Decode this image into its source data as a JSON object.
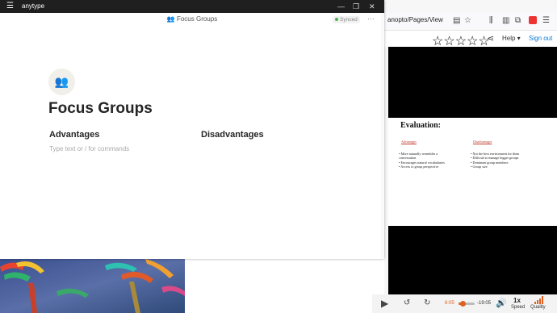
{
  "anytype": {
    "app_name": "anytype",
    "header_title": "👥 Focus Groups",
    "synced_label": "Synced",
    "more_label": "···",
    "page_icon": "👥",
    "page_title": "Focus Groups",
    "advantages_heading": "Advantages",
    "disadvantages_heading": "Disadvantages",
    "placeholder": "Type text or / for commands",
    "window_controls": {
      "minimize": "—",
      "maximize": "❐",
      "close": "✕"
    }
  },
  "browser": {
    "url_fragment": "anopto/Pages/View",
    "stars": "☆☆☆☆☆",
    "help_label": "Help ▾",
    "signout_label": "Sign out",
    "share_icon": "share-icon"
  },
  "slide": {
    "title": "Evaluation:",
    "advantages_label": "Advantages",
    "disadvantages_label": "Disadvantages",
    "advantages": [
      "More naturally resembles a conversation",
      "Encourages natural vocabularies",
      "Access to group perspective"
    ],
    "disadvantages": [
      "Not the best environment for them",
      "Difficult to manage bigger groups",
      "Dominant group members",
      "Group size"
    ]
  },
  "player": {
    "current_time": "6:05",
    "remaining_time": "-19:05",
    "progress": 0.24,
    "speed_value": "1x",
    "speed_label": "Speed",
    "quality_label": "Quality"
  },
  "colors": {
    "player_accent": "#e06020",
    "signout": "#0a7bd6",
    "slide_heading": "#c0392b",
    "titlebar": "#1f1f1f"
  }
}
